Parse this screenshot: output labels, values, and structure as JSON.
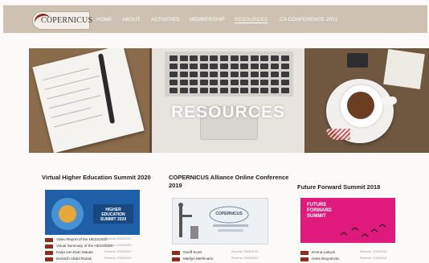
{
  "header": {
    "logo_text": "COPERNICUS",
    "nav": [
      "HOME",
      "ABOUT",
      "ACTIVITIES",
      "MEMBERSHIP",
      "RESOURCES",
      "CA CONFERENCE 2021"
    ],
    "active_nav": "RESOURCES"
  },
  "banner": {
    "title": "RESOURCES"
  },
  "cards": [
    {
      "title": "Virtual Higher Education Summit 2020",
      "thumb_text": "HIGHER EDUCATION SUMMIT 2020",
      "rows": [
        {
          "text": "Video Report of the HESS2020",
          "meta": "Records: 20/06/2020"
        },
        {
          "text": "Visual Summary of the HESS2020",
          "meta": "Records: 20/06/2020"
        },
        {
          "text": "Kwija van Dam Marais",
          "meta": "Records: 20/06/2020"
        },
        {
          "text": "Deutsch Abdul Razak",
          "meta": "Records: 20/06/2020"
        }
      ]
    },
    {
      "title": "COPERNICUS Alliance Online Conference 2019",
      "thumb_text": "COPERNICUS",
      "rows": [
        {
          "text": "Geoff Scott",
          "meta": "Records: 25/06/2019"
        },
        {
          "text": "Marilyn Mehlmann",
          "meta": "Records: 25/06/2019"
        }
      ]
    },
    {
      "title": "Future Forward Summit 2018",
      "thumb_text": "FUTURE FORWARD SUMMIT",
      "rows": [
        {
          "text": "Emma Lakuck",
          "meta": "Records: 17/06/2018"
        },
        {
          "text": "Hans Bruyninckx",
          "meta": "Records: 17/06/2018"
        }
      ]
    }
  ],
  "colors": {
    "header_bg": "#cdc2b1",
    "accent": "#8d2d22",
    "thumb_blue": "#1f5fa8",
    "thumb_pink": "#e0197c"
  }
}
